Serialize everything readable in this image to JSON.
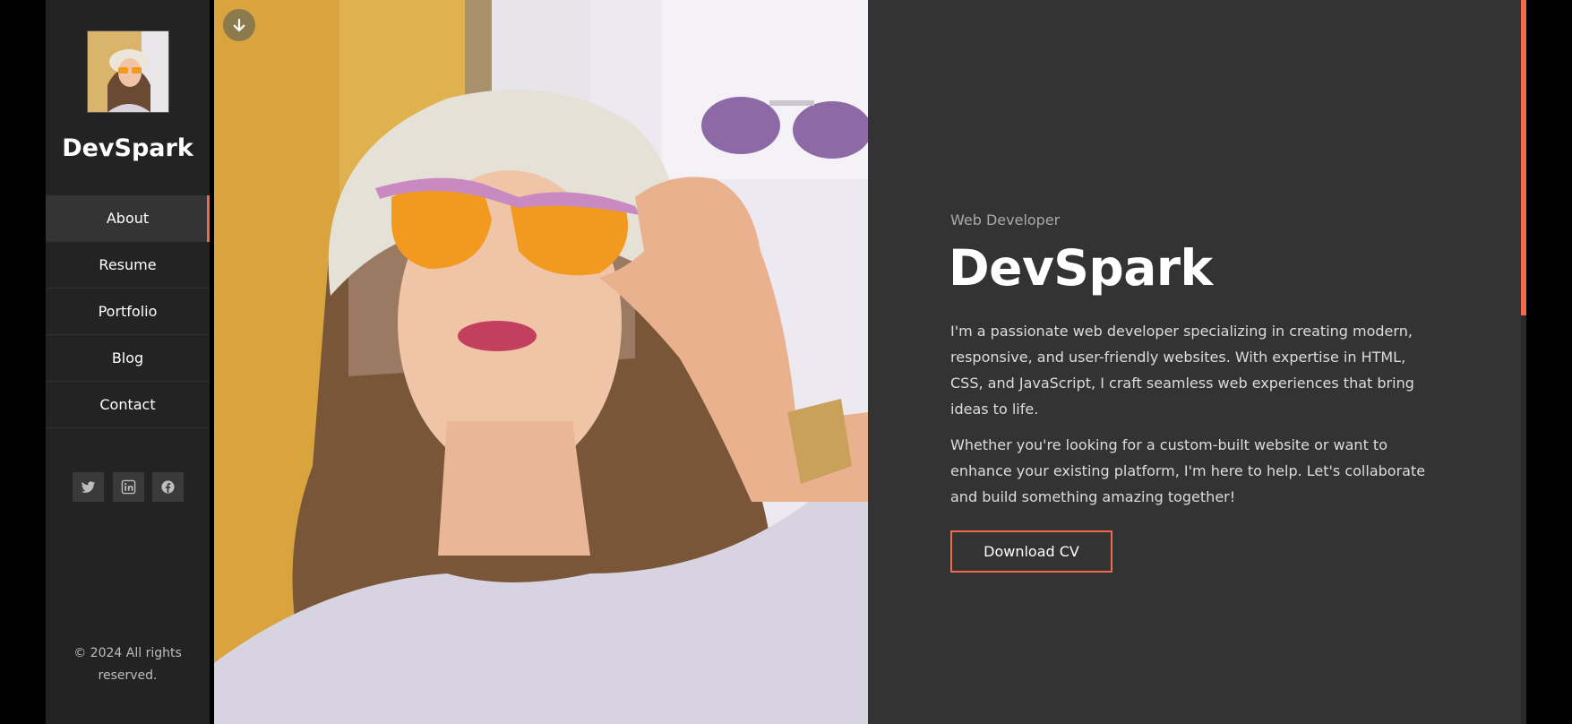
{
  "sidebar": {
    "brand": "DevSpark",
    "nav": [
      {
        "label": "About",
        "active": true
      },
      {
        "label": "Resume",
        "active": false
      },
      {
        "label": "Portfolio",
        "active": false
      },
      {
        "label": "Blog",
        "active": false
      },
      {
        "label": "Contact",
        "active": false
      }
    ],
    "social_icons": [
      "twitter-icon",
      "linkedin-icon",
      "facebook-icon"
    ],
    "copyright": "© 2024 All rights reserved."
  },
  "hero": {
    "scroll_icon": "arrow-down-icon"
  },
  "content": {
    "role": "Web Developer",
    "title": "DevSpark",
    "paragraph1": "I'm a passionate web developer specializing in creating modern, responsive, and user-friendly websites. With expertise in HTML, CSS, and JavaScript, I craft seamless web experiences that bring ideas to life.",
    "paragraph2": "Whether you're looking for a custom-built website or want to enhance your existing platform, I'm here to help. Let's collaborate and build something amazing together!",
    "download_label": "Download CV"
  },
  "colors": {
    "accent": "#f26a4b",
    "sidebar_bg": "#232323",
    "content_bg": "#333333"
  }
}
